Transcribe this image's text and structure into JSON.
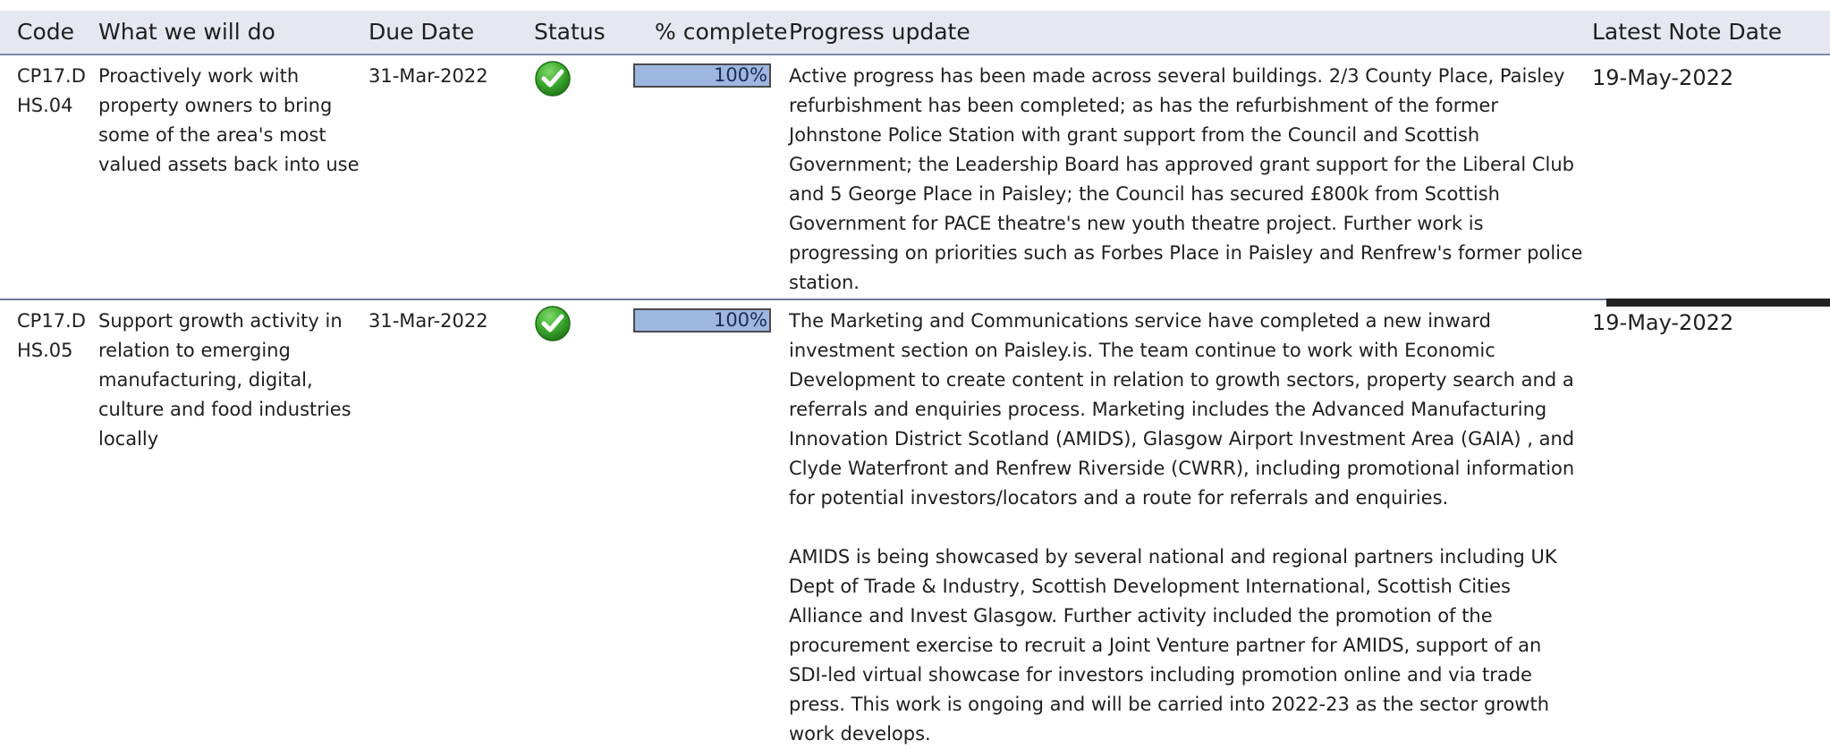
{
  "table": {
    "headers": {
      "code": "Code",
      "what": "What we will do",
      "due": "Due Date",
      "status": "Status",
      "pct": "% complete",
      "progress": "Progress update",
      "note_date": "Latest Note Date"
    },
    "rows": [
      {
        "code": "CP17.DHS.04",
        "what": "Proactively work with property owners to bring some of the area's most valued assets back into use",
        "due": "31-Mar-2022",
        "status_icon": "check-circle-icon",
        "status_color": "#3aa82c",
        "pct_value": 100,
        "pct_label": "100%",
        "progress": [
          "Active progress has been made across several buildings. 2/3 County Place, Paisley refurbishment has been completed; as has the refurbishment of the former Johnstone Police Station with grant support from the Council and Scottish Government; the Leadership Board has approved grant support for the Liberal Club and 5 George Place in Paisley; the Council has secured £800k from Scottish Government for PACE theatre's new youth theatre project. Further work is progressing on priorities such as Forbes Place in Paisley and Renfrew's former police station."
        ],
        "note_date": "19-May-2022"
      },
      {
        "code": "CP17.DHS.05",
        "what": "Support growth activity in relation to emerging manufacturing, digital, culture and food industries locally",
        "due": "31-Mar-2022",
        "status_icon": "check-circle-icon",
        "status_color": "#3aa82c",
        "pct_value": 100,
        "pct_label": "100%",
        "progress": [
          "The Marketing and Communications service have completed a new inward investment section on Paisley.is. The team continue to work with Economic Development to create content in relation to growth sectors, property search and a referrals and enquiries process. Marketing includes the Advanced Manufacturing Innovation District Scotland (AMIDS), Glasgow Airport Investment Area (GAIA) , and Clyde Waterfront and Renfrew Riverside (CWRR), including promotional information for potential investors/locators and a route for referrals and enquiries.",
          "AMIDS is being showcased by several national and regional partners including UK Dept of Trade & Industry, Scottish Development International, Scottish Cities Alliance and Invest Glasgow. Further activity included the promotion of the procurement exercise to recruit a Joint Venture partner for AMIDS, support of an SDI-led virtual showcase for investors including promotion online and via trade press. This work is ongoing and will be carried into 2022-23 as the sector growth work develops."
        ],
        "note_date": "19-May-2022"
      }
    ]
  }
}
